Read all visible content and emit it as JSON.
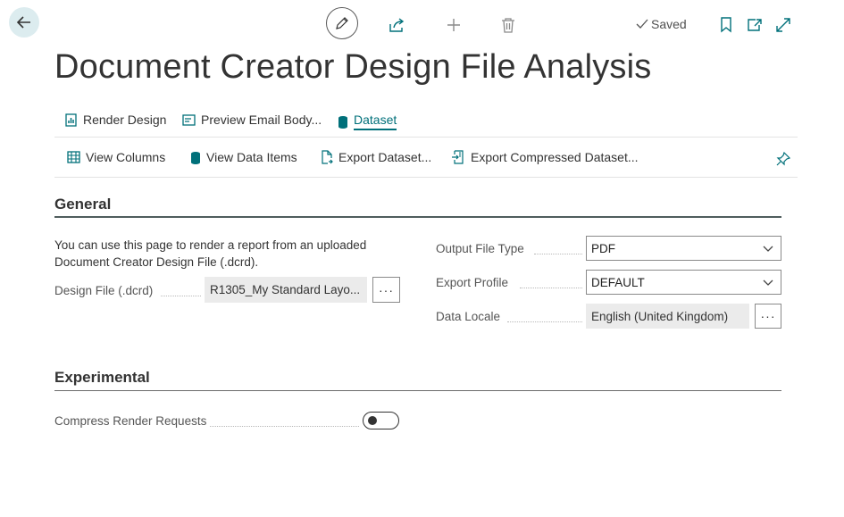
{
  "toolbar": {
    "back_icon": "arrow-left-icon",
    "edit_icon": "pencil-icon",
    "share_icon": "share-icon",
    "new_icon": "plus-icon",
    "delete_icon": "trash-icon",
    "saved_label": "Saved",
    "bookmark_icon": "bookmark-icon",
    "open_new_window_icon": "open-in-new-window-icon",
    "expand_icon": "expand-icon"
  },
  "page": {
    "title": "Document Creator Design File Analysis"
  },
  "tabs": [
    {
      "label": "Render Design",
      "icon": "report-icon"
    },
    {
      "label": "Preview Email Body...",
      "icon": "email-preview-icon"
    },
    {
      "label": "Dataset",
      "icon": "database-icon",
      "active": true
    }
  ],
  "actions": [
    {
      "label": "View Columns",
      "icon": "columns-icon"
    },
    {
      "label": "View Data Items",
      "icon": "database-icon"
    },
    {
      "label": "Export Dataset...",
      "icon": "export-file-icon"
    },
    {
      "label": "Export Compressed Dataset...",
      "icon": "export-compressed-icon"
    }
  ],
  "pin_icon": "pin-icon",
  "general": {
    "title": "General",
    "description": "You can use this page to render a report from an uploaded Document Creator Design File (.dcrd).",
    "design_file": {
      "label": "Design File (.dcrd)",
      "value": "R1305_My Standard Layo...",
      "button": "···"
    },
    "output_file_type": {
      "label": "Output File Type",
      "value": "PDF"
    },
    "export_profile": {
      "label": "Export Profile",
      "value": "DEFAULT"
    },
    "data_locale": {
      "label": "Data Locale",
      "value": "English (United Kingdom)",
      "button": "···"
    }
  },
  "experimental": {
    "title": "Experimental",
    "compress": {
      "label": "Compress Render Requests",
      "enabled": false
    }
  },
  "colors": {
    "accent": "#00707a",
    "back_button_bg": "#dcecef",
    "icon": "#00707a"
  }
}
